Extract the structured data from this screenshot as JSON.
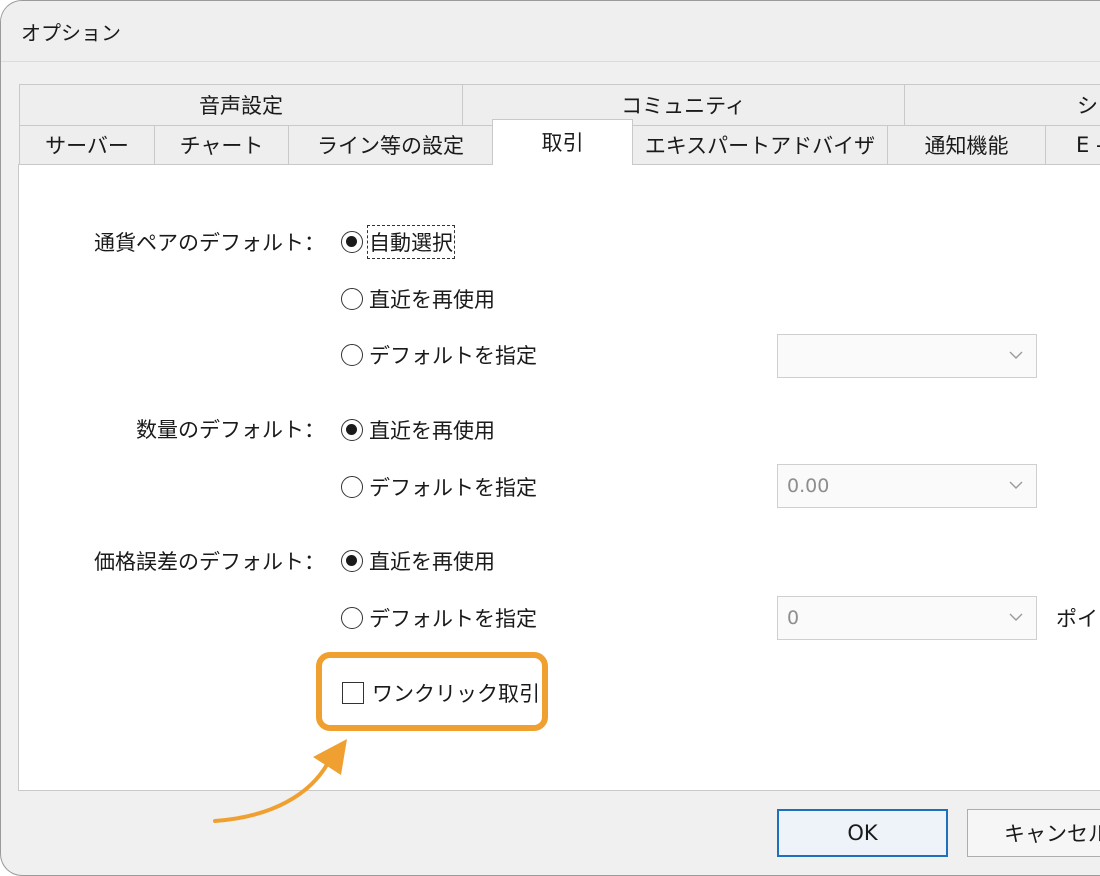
{
  "window": {
    "title": "オプション"
  },
  "tabs_row1": [
    {
      "label": "音声設定"
    },
    {
      "label": "コミュニティ"
    },
    {
      "label": "シ"
    }
  ],
  "tabs_row2": [
    {
      "label": "サーバー"
    },
    {
      "label": "チャート"
    },
    {
      "label": "ライン等の設定"
    },
    {
      "label": "取引",
      "active": true
    },
    {
      "label": "エキスパートアドバイザ"
    },
    {
      "label": "通知機能"
    },
    {
      "label": "E -"
    }
  ],
  "symbol_default": {
    "label": "通貨ペアのデフォルト：",
    "options": [
      "自動選択",
      "直近を再使用",
      "デフォルトを指定"
    ],
    "selected": "自動選択",
    "combo_value": ""
  },
  "volume_default": {
    "label": "数量のデフォルト：",
    "options": [
      "直近を再使用",
      "デフォルトを指定"
    ],
    "selected": "直近を再使用",
    "combo_value": "0.00"
  },
  "deviation_default": {
    "label": "価格誤差のデフォルト：",
    "options": [
      "直近を再使用",
      "デフォルトを指定"
    ],
    "selected": "直近を再使用",
    "combo_value": "0",
    "unit": "ポイン"
  },
  "one_click": {
    "label": "ワンクリック取引",
    "checked": false
  },
  "buttons": {
    "ok": "OK",
    "cancel": "キャンセル"
  },
  "colors": {
    "highlight": "#f0a030",
    "default_button": "#1f6fbf"
  }
}
